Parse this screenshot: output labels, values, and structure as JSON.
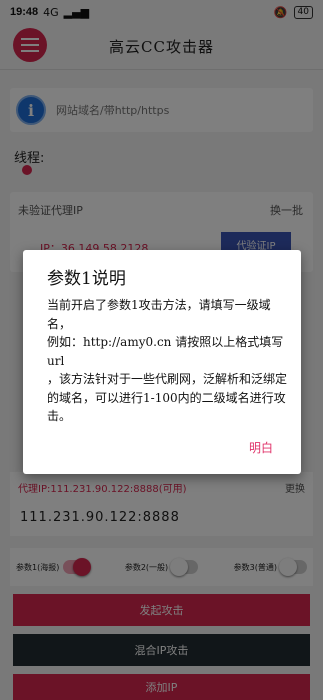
{
  "status_bar": {
    "time": "19:48",
    "network": "4G",
    "speed": "0.00 KB/S",
    "battery": "40"
  },
  "header": {
    "title": "高云CC攻击器"
  },
  "url_input": {
    "placeholder": "网站域名/带http/https"
  },
  "thread": {
    "label": "线程:"
  },
  "proxy": {
    "header": "未验证代理IP",
    "refresh": "换一批",
    "ip": "IP：36.149.58.2128",
    "verify_button": "代验证IP"
  },
  "proxy_in_use": {
    "label": "代理IP:111.231.90.122:8888(可用)",
    "switch": "更换",
    "ip": "111.231.90.122:8888"
  },
  "params": [
    {
      "label": "参数1(海报)",
      "on": true
    },
    {
      "label": "参数2(一般)",
      "on": false
    },
    {
      "label": "参数3(普通)",
      "on": false
    }
  ],
  "buttons": {
    "attack": "发起攻击",
    "mixed": "混合IP攻击",
    "add_ip": "添加IP"
  },
  "dialog": {
    "title": "参数1说明",
    "body": "当前开启了参数1攻击方法，请填写一级域名，\n例如：http://amy0.cn 请按照以上格式填写url\n，该方法针对于一些代刷网，泛解析和泛绑定的域名，可以进行1-100内的二级域名进行攻击。",
    "ok": "明白"
  },
  "colors": {
    "accent": "#d6264f",
    "dark_button": "#222c33",
    "info_blue": "#1e6fd9"
  }
}
